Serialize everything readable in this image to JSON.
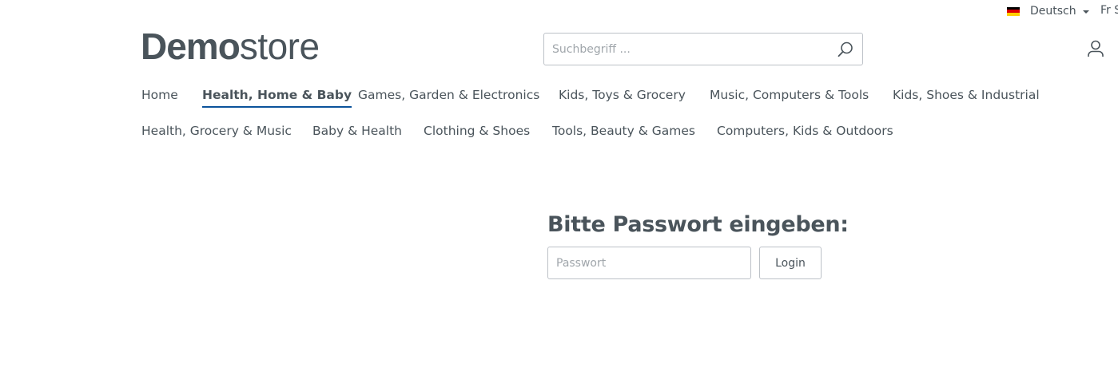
{
  "topbar": {
    "language": {
      "label": "Deutsch",
      "flag_colors": [
        "#000000",
        "#dd0000",
        "#ffce00"
      ]
    },
    "currency": {
      "label": "Fr S"
    }
  },
  "header": {
    "logo": {
      "bold": "Demo",
      "light": "store"
    },
    "search": {
      "placeholder": "Suchbegriff ..."
    },
    "account_icon": "user-icon"
  },
  "nav": {
    "active_color": "#0b539b",
    "items": [
      {
        "label": "Home",
        "active": false
      },
      {
        "label": "Health, Home & Baby",
        "active": true
      },
      {
        "label": "Games, Garden & Electronics",
        "active": false
      },
      {
        "label": "Kids, Toys & Grocery",
        "active": false
      },
      {
        "label": "Music, Computers & Tools",
        "active": false
      },
      {
        "label": "Kids, Shoes & Industrial",
        "active": false
      },
      {
        "label": "Health, Grocery & Music",
        "active": false
      },
      {
        "label": "Baby & Health",
        "active": false
      },
      {
        "label": "Clothing & Shoes",
        "active": false
      },
      {
        "label": "Tools, Beauty & Games",
        "active": false
      },
      {
        "label": "Computers, Kids & Outdoors",
        "active": false
      }
    ]
  },
  "password_form": {
    "title": "Bitte Passwort eingeben:",
    "placeholder": "Passwort",
    "value": "",
    "button_label": "Login"
  }
}
